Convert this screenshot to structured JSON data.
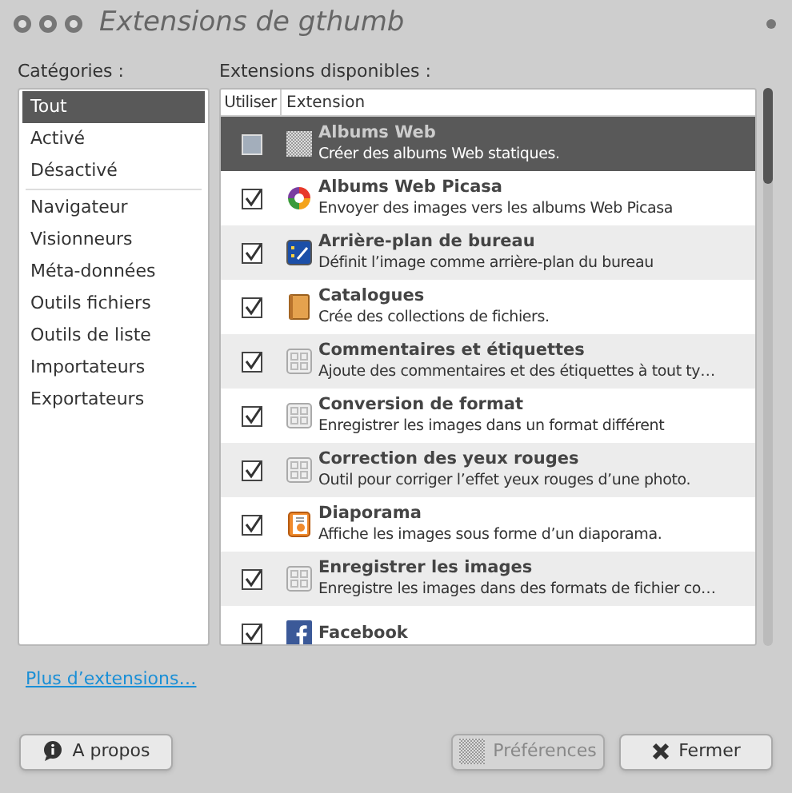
{
  "window": {
    "title": "Extensions de gthumb"
  },
  "categories": {
    "label": "Catégories :",
    "states": [
      {
        "label": "Tout",
        "selected": true
      },
      {
        "label": "Activé",
        "selected": false
      },
      {
        "label": "Désactivé",
        "selected": false
      }
    ],
    "types": [
      {
        "label": "Navigateur",
        "selected": false
      },
      {
        "label": "Visionneurs",
        "selected": false
      },
      {
        "label": "Méta-données",
        "selected": false
      },
      {
        "label": "Outils fichiers",
        "selected": false
      },
      {
        "label": "Outils de liste",
        "selected": false
      },
      {
        "label": "Importateurs",
        "selected": false
      },
      {
        "label": "Exportateurs",
        "selected": false
      }
    ]
  },
  "extensions": {
    "label": "Extensions disponibles :",
    "columns": [
      "Utiliser",
      "Extension"
    ],
    "rows": [
      {
        "checked": false,
        "selected": true,
        "kind": "checker",
        "title": "Albums Web",
        "description": "Créer des albums Web statiques."
      },
      {
        "checked": true,
        "selected": false,
        "kind": "picasa",
        "title": "Albums Web Picasa",
        "description": "Envoyer des images vers les albums Web Picasa"
      },
      {
        "checked": true,
        "selected": false,
        "kind": "desktop",
        "title": "Arrière-plan de bureau",
        "description": "Définit l’image comme arrière-plan du bureau"
      },
      {
        "checked": true,
        "selected": false,
        "kind": "book",
        "title": "Catalogues",
        "description": "Crée des collections de fichiers."
      },
      {
        "checked": true,
        "selected": false,
        "kind": "plugin",
        "title": "Commentaires et étiquettes",
        "description": "Ajoute des commentaires et des étiquettes à tout ty…"
      },
      {
        "checked": true,
        "selected": false,
        "kind": "plugin",
        "title": "Conversion de format",
        "description": "Enregistrer les images dans un format différent"
      },
      {
        "checked": true,
        "selected": false,
        "kind": "plugin",
        "title": "Correction des yeux rouges",
        "description": "Outil pour corriger l’effet yeux rouges d’une photo."
      },
      {
        "checked": true,
        "selected": false,
        "kind": "slideshow",
        "title": "Diaporama",
        "description": "Affiche les images sous forme d’un diaporama."
      },
      {
        "checked": true,
        "selected": false,
        "kind": "plugin",
        "title": "Enregistrer les images",
        "description": "Enregistre les images dans des formats de fichier co…"
      },
      {
        "checked": true,
        "selected": false,
        "kind": "facebook",
        "title": "Facebook"
      }
    ]
  },
  "link": "Plus d’extensions…",
  "buttons": [
    {
      "label": "A propos",
      "disabled": false
    },
    {
      "label": "Préférences",
      "disabled": true
    },
    {
      "label": "Fermer",
      "disabled": false
    }
  ]
}
